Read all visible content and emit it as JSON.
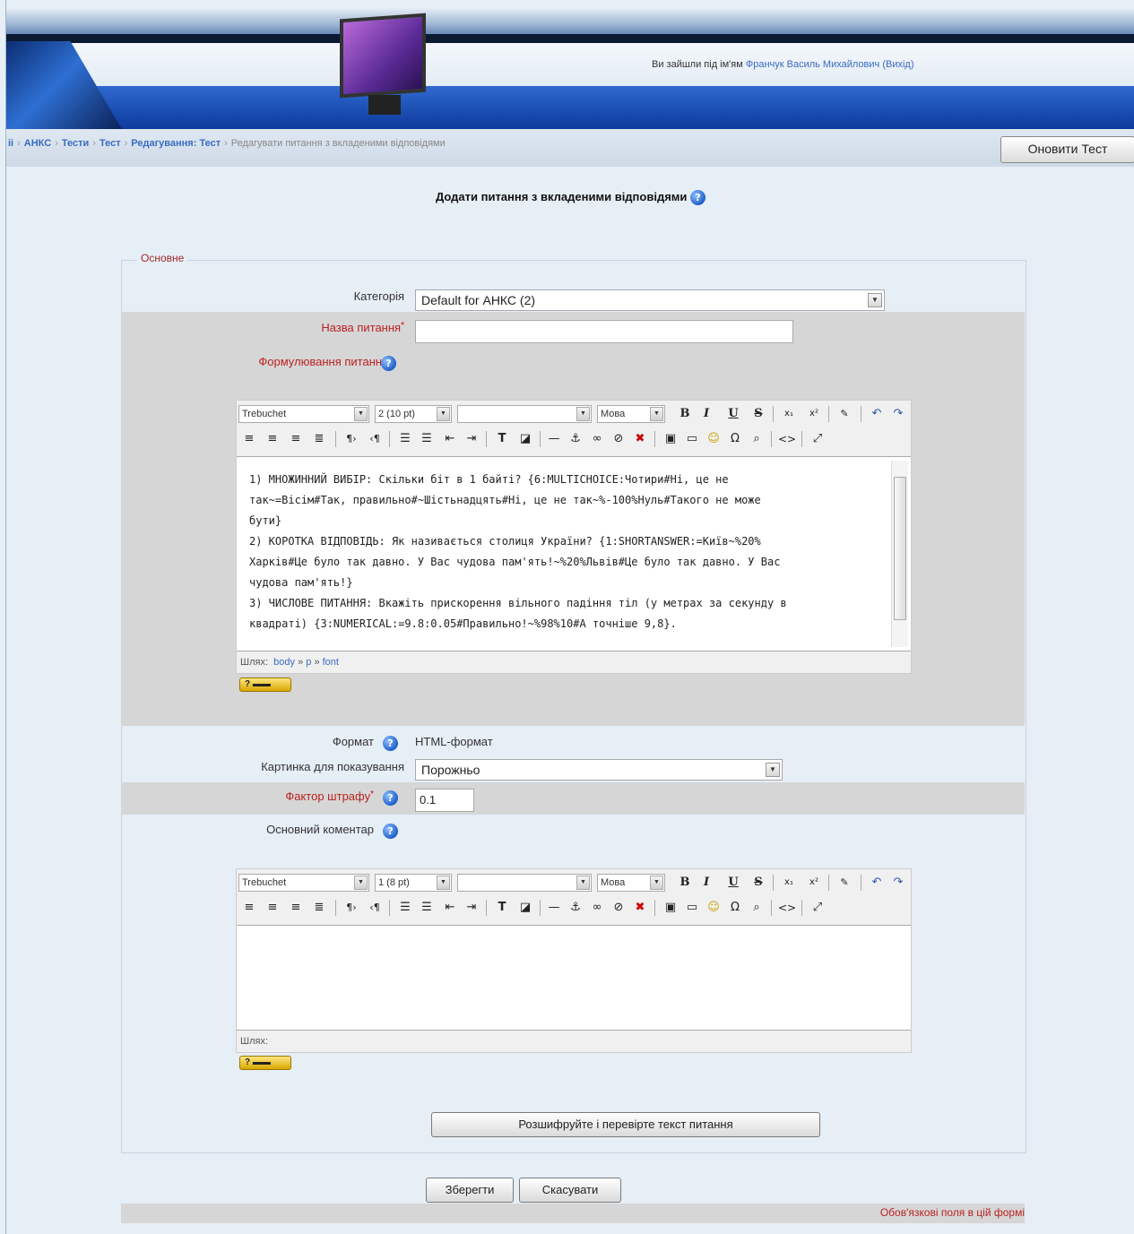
{
  "header": {
    "login_prefix": "Ви зайшли під ім'ям ",
    "user_name": "Франчук Василь Михайлович",
    "logout": "(Вихід)"
  },
  "breadcrumb": {
    "items": [
      "ii",
      "АНКС",
      "Тести",
      "Тест",
      "Редагування: Тест"
    ],
    "current": "Редагувати питання з вкладеними відповідями",
    "separator": "›"
  },
  "nav": {
    "update_button": "Оновити Тест"
  },
  "page_title": "Додати питання з вкладеними відповідями",
  "form": {
    "legend": "Основне",
    "category_label": "Категорія",
    "category_value": "Default for АНКС (2)",
    "name_label": "Назва питання",
    "name_value": "",
    "text_label": "Формулювання питання",
    "editor1": {
      "font": "Trebuchet",
      "size": "2 (10 pt)",
      "heading": "",
      "lang": "Мова",
      "content": [
        "1) МНОЖИННИЙ ВИБІР: Скільки біт в 1 байті? {6:MULTICHOICE:Чотири#Ні, це не",
        "так~=Вісім#Так, правильно#~Шістьнадцять#Ні, це не так~%-100%Нуль#Такого не може",
        "бути}",
        "2) КОРОТКА ВІДПОВІДЬ: Як називається столиця України? {1:SHORTANSWER:=Київ~%20%",
        "Харків#Це було так давно. У Вас чудова пам'ять!~%20%Львів#Це було так давно. У Вас",
        "чудова пам'ять!}",
        "3) ЧИСЛОВЕ ПИТАННЯ: Вкажіть прискорення вільного падіння тіл (у метрах за секунду в",
        "квадраті) {3:NUMERICAL:=9.8:0.05#Правильно!~%98%10#А точніше 9,8}."
      ],
      "path_label": "Шлях:",
      "path_items": [
        "body",
        "p",
        "font"
      ],
      "path_sep": "»"
    },
    "format_label": "Формат",
    "format_value": "HTML-формат",
    "image_label": "Картинка для показування",
    "image_value": "Порожньо",
    "penalty_label": "Фактор штрафу",
    "penalty_value": "0.1",
    "feedback_label": "Основний коментар",
    "editor2": {
      "font": "Trebuchet",
      "size": "1 (8 pt)",
      "heading": "",
      "lang": "Мова",
      "path_label": "Шлях:"
    },
    "decode_button": "Розшифруйте і перевірте текст питання",
    "save_button": "Зберегти",
    "cancel_button": "Скасувати",
    "required_note": "Обов'язкові поля в цій формі"
  },
  "toolbar_icons": {
    "bold": "B",
    "italic": "I",
    "underline": "U",
    "strike": "S",
    "sub": "x₁",
    "sup": "x²",
    "undo": "↶",
    "redo": "↷"
  },
  "colors": {
    "accent_link": "#3a6cc0",
    "required": "#b22222",
    "band_gray": "#d6d6d6",
    "page_bg": "#e6eef6"
  }
}
